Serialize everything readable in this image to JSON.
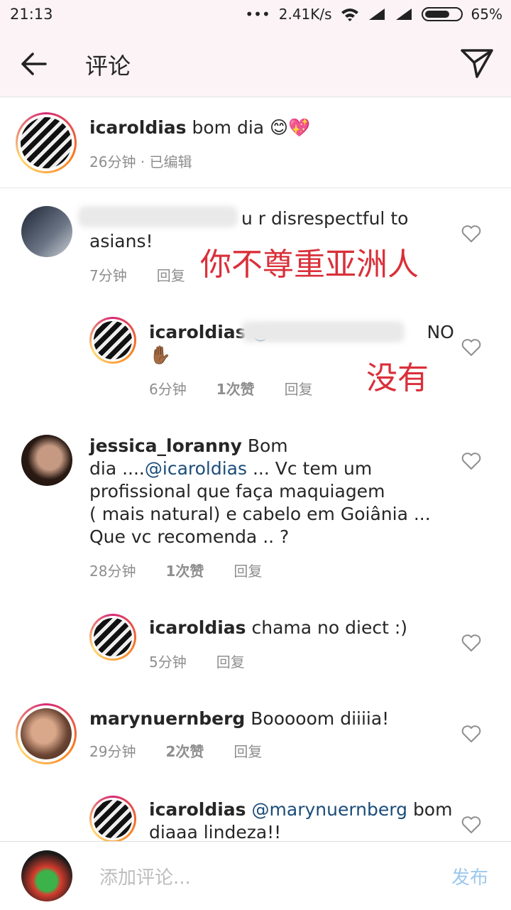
{
  "status": {
    "time": "21:13",
    "dots": "•••",
    "network": "2.41K/s",
    "battery": "65%"
  },
  "header": {
    "title": "评论"
  },
  "caption": {
    "user": "icaroldias",
    "text": "bom dia 😊💖",
    "meta": "26分钟 · 已编辑"
  },
  "comments": [
    {
      "user_line": "u r disrespectful to",
      "text2": "asians!",
      "time": "7分钟",
      "reply": "回复",
      "annotation": "你不尊重亚洲人"
    },
    {
      "user": "icaroldias",
      "mention": "@",
      "text": "NO",
      "emoji": "✋🏾",
      "time": "6分钟",
      "likes": "1次赞",
      "reply": "回复",
      "annotation": "没有"
    },
    {
      "user": "jessica_loranny",
      "lines": [
        "Bom",
        "dia ....",
        "... Vc tem um",
        "profissional que faça maquiagem",
        "( mais natural) e cabelo em Goiânia ...",
        "Que vc recomenda .. ?"
      ],
      "mention": "@icaroldias",
      "time": "28分钟",
      "likes": "1次赞",
      "reply": "回复"
    },
    {
      "user": "icaroldias",
      "text": "chama no diect :)",
      "time": "5分钟",
      "reply": "回复"
    },
    {
      "user": "marynuernberg",
      "text": "Booooom diiiia!",
      "time": "29分钟",
      "likes": "2次赞",
      "reply": "回复"
    },
    {
      "user": "icaroldias",
      "mention": "@marynuernberg",
      "text": "bom",
      "text2": "diaaa lindeza!!"
    }
  ],
  "composer": {
    "placeholder": "添加评论...",
    "post": "发布"
  }
}
